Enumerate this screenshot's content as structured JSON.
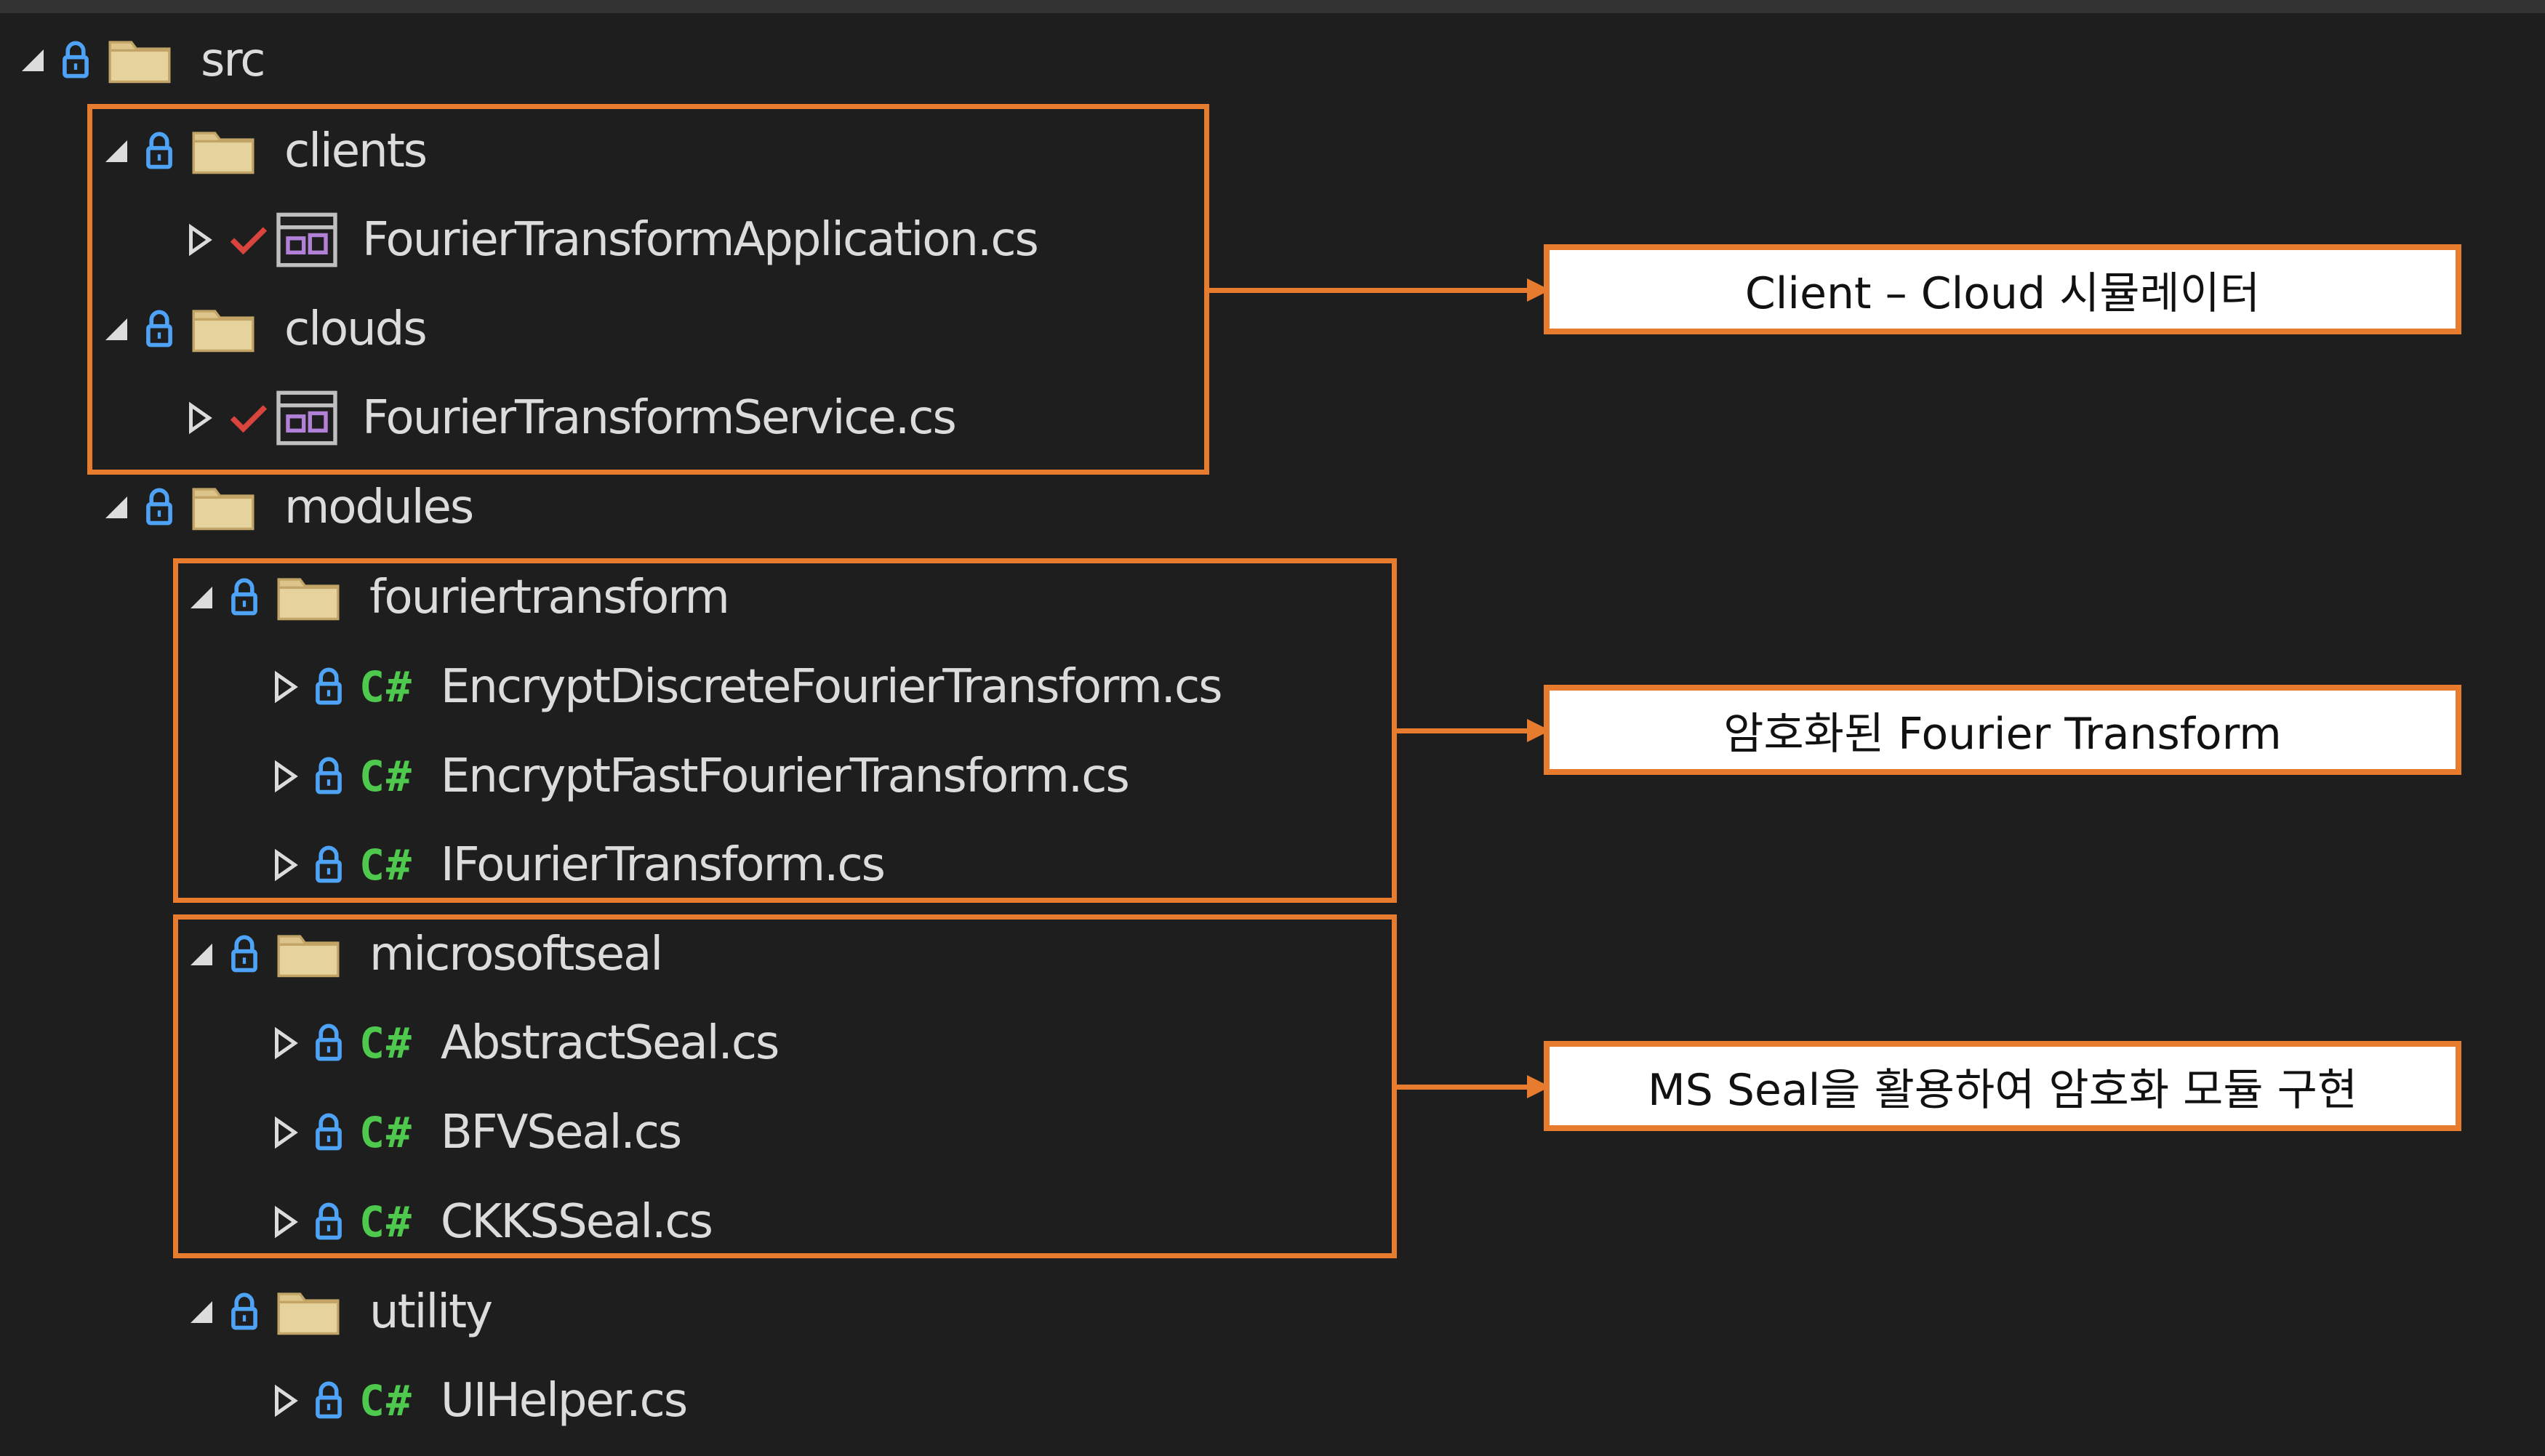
{
  "colors": {
    "background": "#1e1e1e",
    "accent_orange": "#e87c2e",
    "lock_blue": "#4fa3f7",
    "csharp_green": "#4ec94e",
    "folder_tan": "#dcc48a",
    "check_red": "#d9443c",
    "text": "#dcdcdc"
  },
  "tree": {
    "src": {
      "label": "src",
      "icon": "folder-icon"
    },
    "clients": {
      "label": "clients",
      "icon": "folder-icon"
    },
    "fourier_app": {
      "label": "FourierTransformApplication.cs",
      "icon": "cs-app-icon",
      "status": "check-icon"
    },
    "clouds": {
      "label": "clouds",
      "icon": "folder-icon"
    },
    "fourier_service": {
      "label": "FourierTransformService.cs",
      "icon": "cs-app-icon",
      "status": "check-icon"
    },
    "modules": {
      "label": "modules",
      "icon": "folder-icon"
    },
    "fouriertransform": {
      "label": "fouriertransform",
      "icon": "folder-icon"
    },
    "encrypt_dft": {
      "label": "EncryptDiscreteFourierTransform.cs",
      "icon": "csharp-icon"
    },
    "encrypt_fft": {
      "label": "EncryptFastFourierTransform.cs",
      "icon": "csharp-icon"
    },
    "ifourier": {
      "label": "IFourierTransform.cs",
      "icon": "csharp-icon"
    },
    "microsoftseal": {
      "label": "microsoftseal",
      "icon": "folder-icon"
    },
    "abstract_seal": {
      "label": "AbstractSeal.cs",
      "icon": "csharp-icon"
    },
    "bfv_seal": {
      "label": "BFVSeal.cs",
      "icon": "csharp-icon"
    },
    "ckks_seal": {
      "label": "CKKSSeal.cs",
      "icon": "csharp-icon"
    },
    "utility": {
      "label": "utility",
      "icon": "folder-icon"
    },
    "ui_helper": {
      "label": "UIHelper.cs",
      "icon": "csharp-icon"
    }
  },
  "csharp_glyph": "C#",
  "callouts": {
    "client_cloud": "Client – Cloud 시뮬레이터",
    "fourier": "암호화된 Fourier Transform",
    "ms_seal": "MS Seal을 활용하여 암호화 모듈 구현"
  }
}
